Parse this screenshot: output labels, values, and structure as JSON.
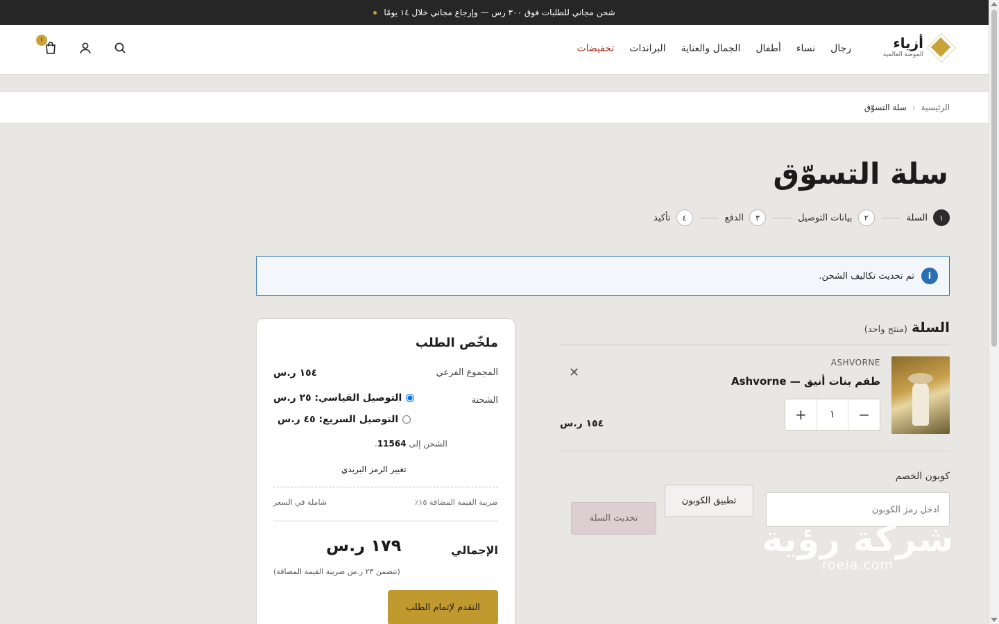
{
  "announcement": "شحن مجاني للطلبات فوق ٣٠٠ رس — وإرجاع مجاني خلال ١٤ يومًا",
  "logo": {
    "name": "أزياء",
    "tagline": "الموضة العالمية"
  },
  "nav": {
    "items": [
      {
        "label": "رجال"
      },
      {
        "label": "نساء"
      },
      {
        "label": "أطفال"
      },
      {
        "label": "الجمال والعناية"
      },
      {
        "label": "البراندات"
      },
      {
        "label": "تخفيضات"
      }
    ]
  },
  "header_tools": {
    "cart_count": "١",
    "icons": [
      "search-icon",
      "user-icon",
      "bag-icon"
    ]
  },
  "breadcrumb": {
    "home": "الرئيسية",
    "separator": "‹",
    "current": "سلة التسوّق"
  },
  "page_title": "سلة التسوّق",
  "steps": [
    {
      "num": "١",
      "label": "السلة"
    },
    {
      "num": "٢",
      "label": "بيانات التوصيل"
    },
    {
      "num": "٣",
      "label": "الدفع"
    },
    {
      "num": "٤",
      "label": "تأكيد"
    }
  ],
  "notice": {
    "icon": "info-icon",
    "text": "تم تحديث تكاليف الشحن."
  },
  "cart": {
    "heading": "السلة",
    "count": "(منتج واحد)",
    "item": {
      "brand": "ASHVORNE",
      "name": "طقم بنات أنيق — Ashvorne",
      "qty": "١",
      "minus": "−",
      "plus": "+",
      "price": "١٥٤ ر.س",
      "remove": "✕"
    },
    "coupon": {
      "label": "كوبون الخصم",
      "placeholder": "أدخل رمز الكوبون",
      "apply": "تطبيق الكوبون",
      "update": "تحديث السلة"
    }
  },
  "summary": {
    "title": "ملخّص الطلب",
    "subtotal_label": "المجموع الفرعي",
    "subtotal_value": "١٥٤ ر.س",
    "shipping_label": "الشحنة",
    "ship_standard": "التوصيل القياسي: ٢٥ ر.س",
    "ship_express": "التوصيل السريع: ٤٥ ر.س",
    "ship_to_prefix": "الشحن إلى",
    "ship_to_zip": "11564",
    "change_zip": "تغيير الرمز البريدي",
    "tax_label": "ضريبة القيمة المضافة ١٥٪",
    "tax_value": "شاملة في السعر",
    "total_label": "الإجمالي",
    "total_value": "١٧٩ ر.س",
    "vat_note": "(تتضمن ٢٣ ر.س ضريبة القيمة المضافة)",
    "checkout": "التقدم لإتمام الطلب"
  },
  "watermark": {
    "arabic": "شركة رؤية",
    "latin": "roeia.com"
  },
  "colors": {
    "accent": "#c09a2e",
    "sale": "#a02f1f",
    "info": "#2a6fb0",
    "topbar": "#262626"
  }
}
